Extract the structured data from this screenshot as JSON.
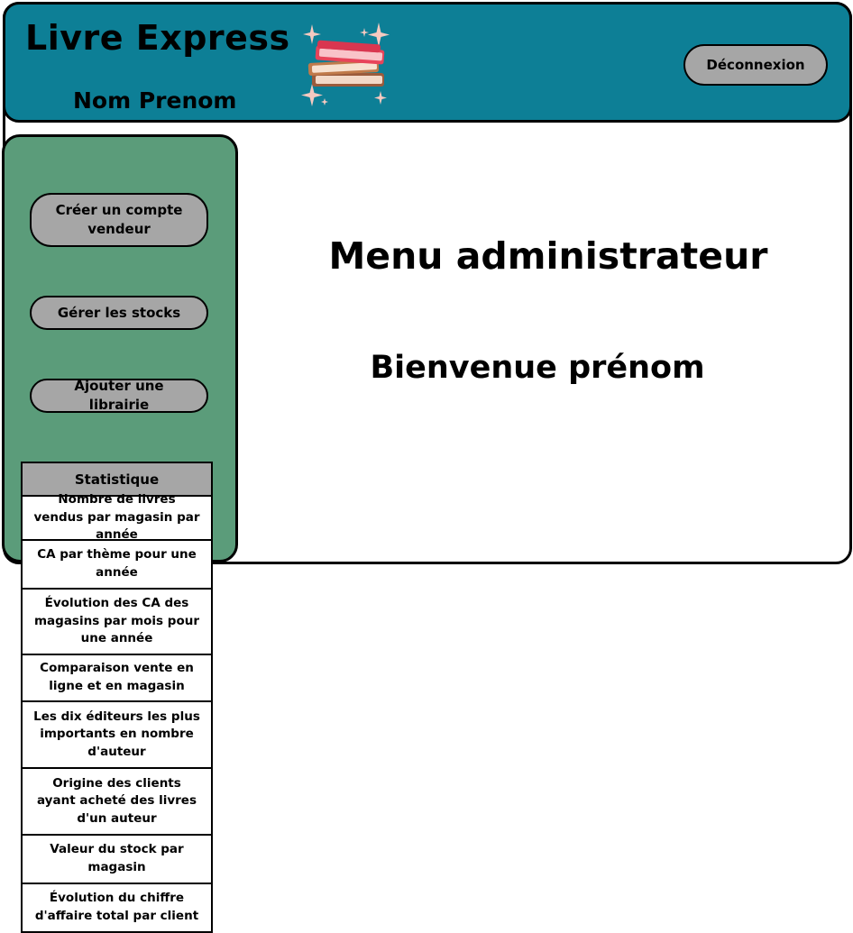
{
  "header": {
    "app_title": "Livre Express",
    "user_name": "Nom Prenom",
    "logout_label": "Déconnexion",
    "logo_icon": "stacked-books-icon",
    "color": "#0d7f96"
  },
  "sidebar": {
    "color": "#5b9c7a",
    "buttons": [
      {
        "label": "Créer un compte vendeur"
      },
      {
        "label": "Gérer les stocks"
      },
      {
        "label": "Ajouter une librairie"
      }
    ]
  },
  "stats": {
    "title": "Statistique",
    "items": [
      {
        "label": "Nombre de livres vendus par magasin par année"
      },
      {
        "label": "CA par thème pour une année"
      },
      {
        "label": "Évolution des CA des magasins par mois pour une année"
      },
      {
        "label": "Comparaison vente en ligne et en magasin"
      },
      {
        "label": "Les dix éditeurs les plus importants en nombre d'auteur"
      },
      {
        "label": "Origine des clients ayant acheté des livres d'un auteur"
      },
      {
        "label": "Valeur du stock par magasin"
      },
      {
        "label": "Évolution du chiffre d'affaire total par client"
      }
    ]
  },
  "main": {
    "title": "Menu administrateur",
    "welcome": "Bienvenue prénom"
  }
}
